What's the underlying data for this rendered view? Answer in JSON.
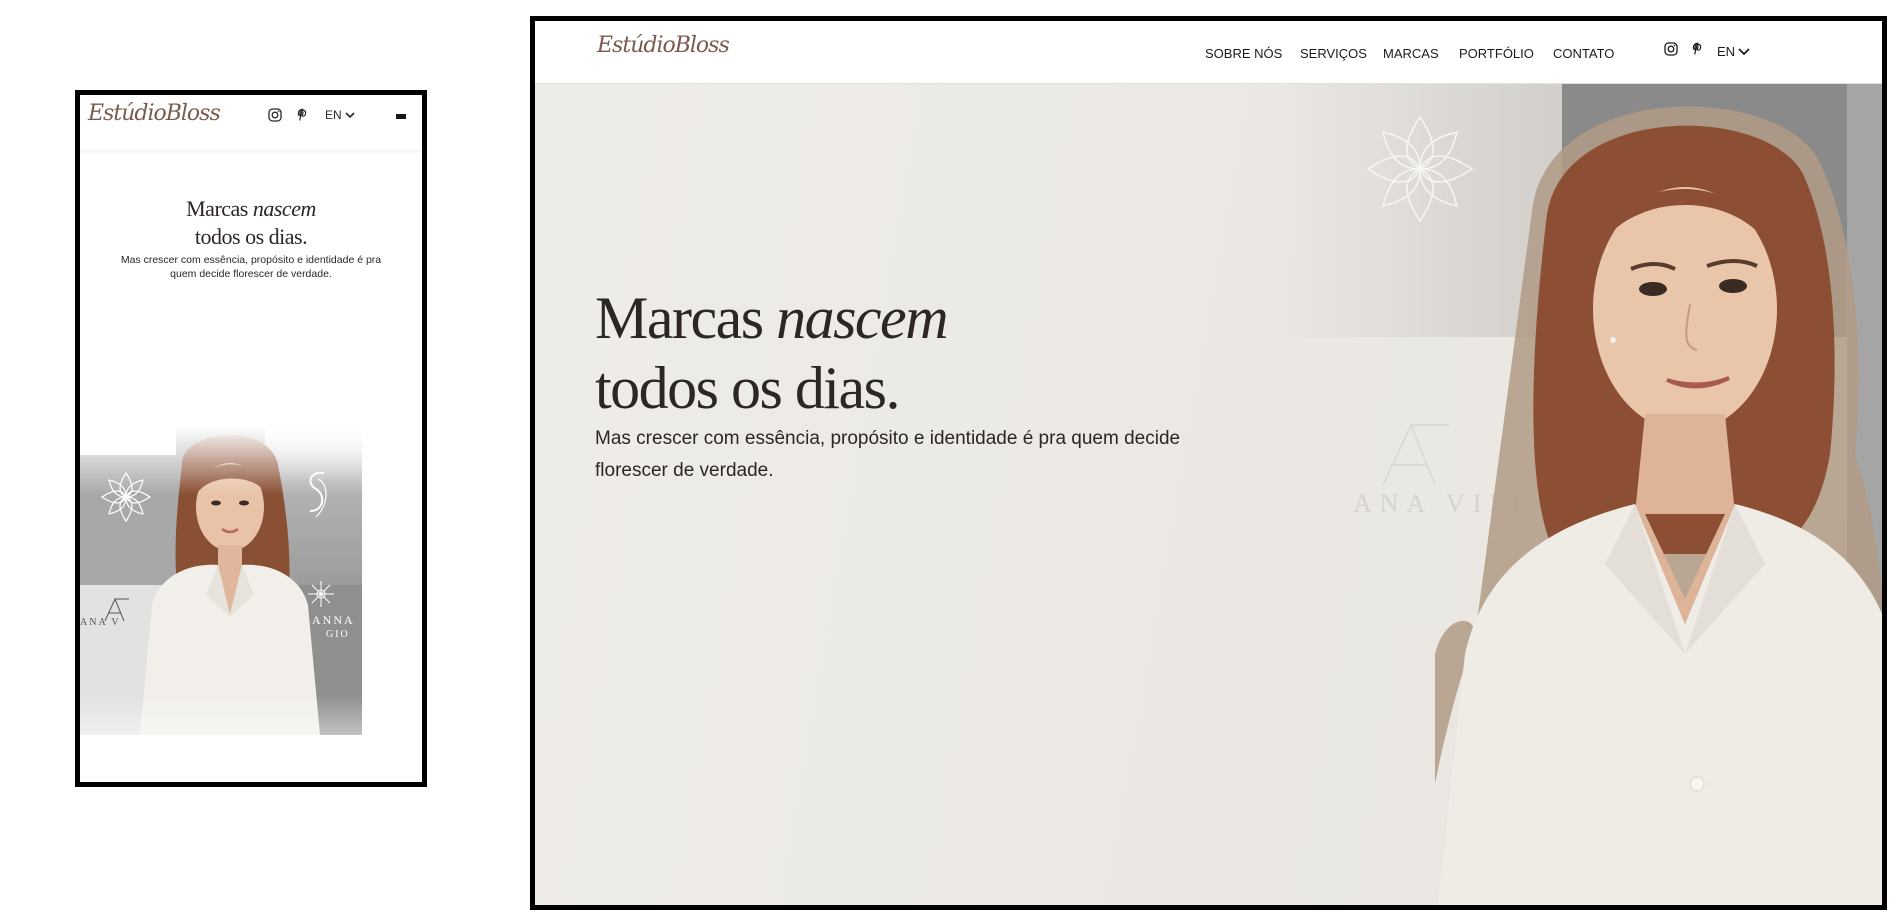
{
  "mobile": {
    "logo": "EstúdioBloss",
    "lang": "EN",
    "hero": {
      "title_plain": "Marcas",
      "title_italic": "nascem",
      "title_line2": "todos os dias.",
      "subtitle": "Mas crescer com essência, propósito e identidade é pra quem decide florescer de verdade."
    },
    "collage": {
      "brand_left": "ANA V",
      "brand_right_1": "ANNA",
      "brand_right_2": "GIO"
    }
  },
  "desktop": {
    "logo": "EstúdioBloss",
    "nav": {
      "about": "SOBRE NÓS",
      "services": "SERVIÇOS",
      "brands": "MARCAS",
      "portfolio": "PORTFÓLIO",
      "contact": "CONTATO"
    },
    "lang": "EN",
    "hero": {
      "title_plain": "Marcas",
      "title_italic": "nascem",
      "title_line2": "todos os dias.",
      "subtitle": "Mas crescer com essência, propósito e identidade é pra quem decide florescer de verdade."
    },
    "collage": {
      "brand_name": "ANA VIEI"
    }
  },
  "icons": {
    "social_1": "instagram-icon",
    "social_2": "pinterest-icon",
    "lang_caret": "chevron-down-icon",
    "menu": "hamburger-menu-icon"
  },
  "colors": {
    "text": "#2d2626",
    "logo": "#7a5a4e",
    "hero_bg": "#eeece9",
    "frame_border": "#000000"
  }
}
